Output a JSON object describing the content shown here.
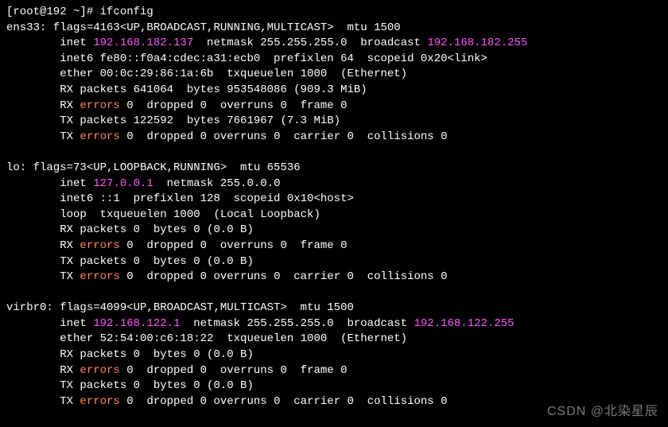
{
  "prompt": "[root@192 ~]# ",
  "command": "ifconfig",
  "colors": {
    "magenta": "#ff55ff",
    "orange": "#ff8855"
  },
  "ens33": {
    "header": "ens33: flags=4163<UP,BROADCAST,RUNNING,MULTICAST>  mtu 1500",
    "inet_prefix": "        inet ",
    "inet_ip": "192.168.182.137",
    "inet_mid": "  netmask 255.255.255.0  broadcast ",
    "inet_bcast": "192.168.182.255",
    "inet6": "        inet6 fe80::f0a4:cdec:a31:ecb0  prefixlen 64  scopeid 0x20<link>",
    "ether": "        ether 00:0c:29:86:1a:6b  txqueuelen 1000  (Ethernet)",
    "rx_packets": "        RX packets 641064  bytes 953548086 (909.3 MiB)",
    "rx_err_pre": "        RX ",
    "rx_err_word": "errors",
    "rx_err_post": " 0  dropped 0  overruns 0  frame 0",
    "tx_packets": "        TX packets 122592  bytes 7661967 (7.3 MiB)",
    "tx_err_pre": "        TX ",
    "tx_err_word": "errors",
    "tx_err_post": " 0  dropped 0 overruns 0  carrier 0  collisions 0"
  },
  "lo": {
    "header": "lo: flags=73<UP,LOOPBACK,RUNNING>  mtu 65536",
    "inet_prefix": "        inet ",
    "inet_ip": "127.0.0.1",
    "inet_mid": "  netmask 255.0.0.0",
    "inet6": "        inet6 ::1  prefixlen 128  scopeid 0x10<host>",
    "loop": "        loop  txqueuelen 1000  (Local Loopback)",
    "rx_packets": "        RX packets 0  bytes 0 (0.0 B)",
    "rx_err_pre": "        RX ",
    "rx_err_word": "errors",
    "rx_err_post": " 0  dropped 0  overruns 0  frame 0",
    "tx_packets": "        TX packets 0  bytes 0 (0.0 B)",
    "tx_err_pre": "        TX ",
    "tx_err_word": "errors",
    "tx_err_post": " 0  dropped 0 overruns 0  carrier 0  collisions 0"
  },
  "virbr0": {
    "header": "virbr0: flags=4099<UP,BROADCAST,MULTICAST>  mtu 1500",
    "inet_prefix": "        inet ",
    "inet_ip": "192.168.122.1",
    "inet_mid": "  netmask 255.255.255.0  broadcast ",
    "inet_bcast": "192.168.122.255",
    "ether": "        ether 52:54:00:c6:18:22  txqueuelen 1000  (Ethernet)",
    "rx_packets": "        RX packets 0  bytes 0 (0.0 B)",
    "rx_err_pre": "        RX ",
    "rx_err_word": "errors",
    "rx_err_post": " 0  dropped 0  overruns 0  frame 0",
    "tx_packets": "        TX packets 0  bytes 0 (0.0 B)",
    "tx_err_pre": "        TX ",
    "tx_err_word": "errors",
    "tx_err_post": " 0  dropped 0 overruns 0  carrier 0  collisions 0"
  },
  "watermark": "CSDN @北染星辰"
}
